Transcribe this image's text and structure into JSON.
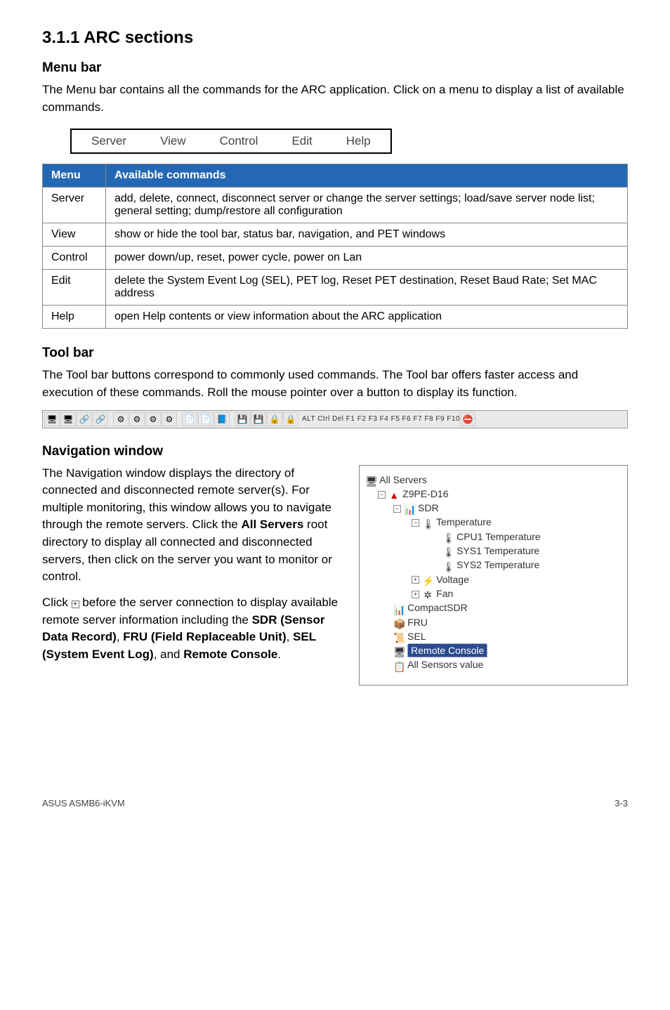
{
  "heading_section": "3.1.1    ARC sections",
  "menubar": {
    "h": "Menu bar",
    "p": "The Menu bar contains all the commands for the ARC application. Click on a menu to display a list of available commands.",
    "items": [
      "Server",
      "View",
      "Control",
      "Edit",
      "Help"
    ],
    "th1": "Menu",
    "th2": "Available commands",
    "rows": [
      {
        "m": "Server",
        "d": "add, delete, connect, disconnect server or change the server settings; load/save server node list; general setting; dump/restore all configuration"
      },
      {
        "m": "View",
        "d": "show or hide the tool bar, status bar, navigation, and PET windows"
      },
      {
        "m": "Control",
        "d": "power down/up, reset, power cycle, power on Lan"
      },
      {
        "m": "Edit",
        "d": "delete the System Event Log (SEL), PET log, Reset PET destination, Reset Baud Rate; Set MAC address"
      },
      {
        "m": "Help",
        "d": "open Help contents or view information about the ARC application"
      }
    ]
  },
  "toolbar": {
    "h": "Tool bar",
    "p": "The Tool bar buttons correspond to commonly used commands. The Tool bar offers faster access and execution of these commands. Roll the mouse pointer over a button to display its function.",
    "keys": "ALT Ctrl Del F1 F2 F3 F4 F5 F6 F7 F8 F9 F10"
  },
  "nav": {
    "h": "Navigation window",
    "p1a": "The Navigation window displays the directory of connected and disconnected remote server(s). For multiple monitoring, this window allows you to navigate through the remote servers. Click the ",
    "p1b": "All Servers",
    "p1c": " root directory to display all connected and disconnected servers, then click on the server you want to monitor or control.",
    "p2a": "Click ",
    "p2b": " before the server connection to display available remote server information including the ",
    "sdr": "SDR (Sensor Data Record)",
    "fru": "FRU (Field Replaceable Unit)",
    "sel": "SEL (System Event Log)",
    "rc": "Remote Console",
    "comma": ", ",
    "and": ", and ",
    "period": "."
  },
  "tree": {
    "root": "All Servers",
    "server": "Z9PE-D16",
    "sdr": "SDR",
    "temp": "Temperature",
    "t1": "CPU1 Temperature",
    "t2": "SYS1 Temperature",
    "t3": "SYS2 Temperature",
    "volt": "Voltage",
    "fan": "Fan",
    "csdr": "CompactSDR",
    "fru": "FRU",
    "sel": "SEL",
    "rc": "Remote Console",
    "asv": "All Sensors value"
  },
  "footer": {
    "left": "ASUS ASMB6-iKVM",
    "right": "3-3"
  },
  "plus": "+",
  "minus": "−"
}
